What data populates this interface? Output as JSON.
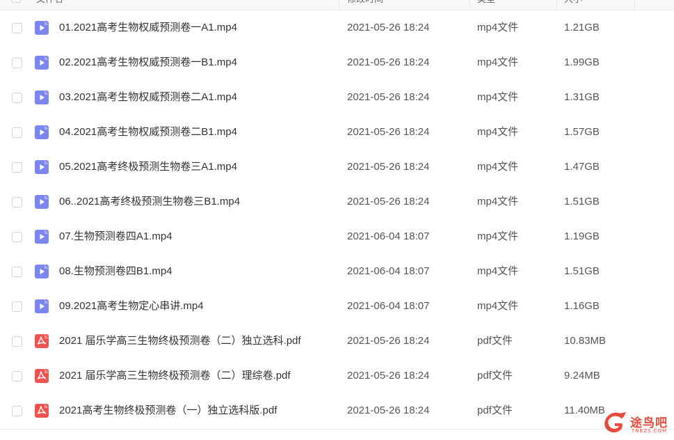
{
  "header": {
    "name_label": "文件名",
    "mtime_label": "修改时间",
    "type_label": "类型",
    "size_label": "大小"
  },
  "files": [
    {
      "name": "01.2021高考生物权威预测卷一A1.mp4",
      "mtime": "2021-05-26 18:24",
      "type": "mp4文件",
      "size": "1.21GB",
      "kind": "video"
    },
    {
      "name": "02.2021高考生物权威预测卷一B1.mp4",
      "mtime": "2021-05-26 18:24",
      "type": "mp4文件",
      "size": "1.99GB",
      "kind": "video"
    },
    {
      "name": "03.2021高考生物权威预测卷二A1.mp4",
      "mtime": "2021-05-26 18:24",
      "type": "mp4文件",
      "size": "1.31GB",
      "kind": "video"
    },
    {
      "name": "04.2021高考生物权威预测卷二B1.mp4",
      "mtime": "2021-05-26 18:24",
      "type": "mp4文件",
      "size": "1.57GB",
      "kind": "video"
    },
    {
      "name": "05.2021高考终极预测生物卷三A1.mp4",
      "mtime": "2021-05-26 18:24",
      "type": "mp4文件",
      "size": "1.47GB",
      "kind": "video"
    },
    {
      "name": "06..2021高考终极预测生物卷三B1.mp4",
      "mtime": "2021-05-26 18:24",
      "type": "mp4文件",
      "size": "1.51GB",
      "kind": "video"
    },
    {
      "name": "07.生物预测卷四A1.mp4",
      "mtime": "2021-06-04 18:07",
      "type": "mp4文件",
      "size": "1.19GB",
      "kind": "video"
    },
    {
      "name": "08.生物预测卷四B1.mp4",
      "mtime": "2021-06-04 18:07",
      "type": "mp4文件",
      "size": "1.51GB",
      "kind": "video"
    },
    {
      "name": "09.2021高考生物定心串讲.mp4",
      "mtime": "2021-06-04 18:07",
      "type": "mp4文件",
      "size": "1.16GB",
      "kind": "video"
    },
    {
      "name": "2021 届乐学高三生物终极预测卷（二）独立选科.pdf",
      "mtime": "2021-05-26 18:24",
      "type": "pdf文件",
      "size": "10.83MB",
      "kind": "pdf"
    },
    {
      "name": "2021 届乐学高三生物终极预测卷（二）理综卷.pdf",
      "mtime": "2021-05-26 18:24",
      "type": "pdf文件",
      "size": "9.24MB",
      "kind": "pdf"
    },
    {
      "name": "2021高考生物终极预测卷（一）独立选科版.pdf",
      "mtime": "2021-05-26 18:24",
      "type": "pdf文件",
      "size": "11.40MB",
      "kind": "pdf"
    }
  ],
  "icons": {
    "video": "video-file-icon",
    "pdf": "pdf-file-icon"
  },
  "colors": {
    "video_icon": "#7b86f0",
    "pdf_icon": "#f0524f",
    "watermark": "#e84b3c"
  },
  "watermark": {
    "text": "途鸟吧",
    "url": "TNBZS.COM"
  }
}
